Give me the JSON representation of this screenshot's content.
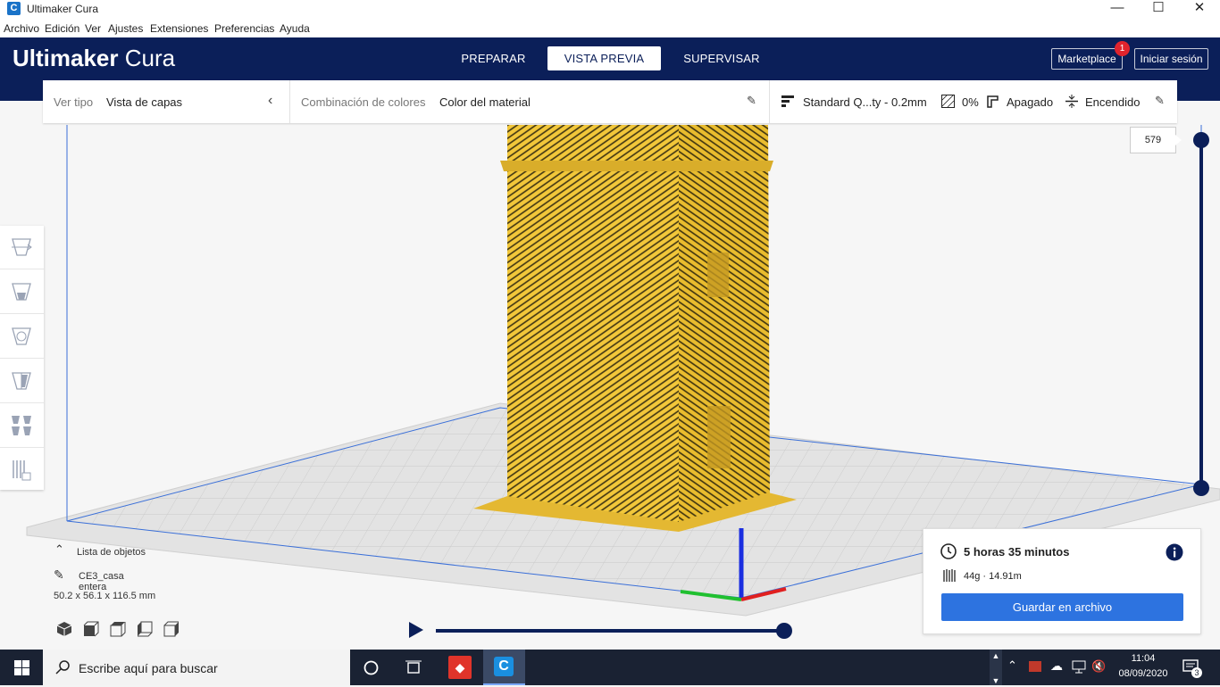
{
  "window": {
    "title": "Ultimaker Cura",
    "app_icon": "cura-icon",
    "minimize": "—",
    "maximize": "☐",
    "close": "✕"
  },
  "menu": [
    "Archivo",
    "Edición",
    "Ver",
    "Ajustes",
    "Extensiones",
    "Preferencias",
    "Ayuda"
  ],
  "header": {
    "brand_bold": "Ultimaker",
    "brand_light": "Cura",
    "tabs": [
      {
        "label": "PREPARAR",
        "active": false
      },
      {
        "label": "VISTA PREVIA",
        "active": true
      },
      {
        "label": "SUPERVISAR",
        "active": false
      }
    ],
    "marketplace": "Marketplace",
    "marketplace_badge": "1",
    "signin": "Iniciar sesión"
  },
  "viewbar": {
    "view_type_label": "Ver tipo",
    "view_type_value": "Vista de capas",
    "color_scheme_label": "Combinación de colores",
    "color_scheme_value": "Color del material",
    "profile": "Standard Q...ty - 0.2mm",
    "infill": "0%",
    "support": "Apagado",
    "adhesion": "Encendido"
  },
  "layer_slider": {
    "current_layer": "579"
  },
  "object_list": {
    "header": "Lista de objetos",
    "object_name": "CE3_casa entera",
    "dimensions": "50.2 x 56.1 x 116.5 mm"
  },
  "print_info": {
    "time": "5 horas 35 minutos",
    "material": "44g · 14.91m",
    "save_button": "Guardar en archivo"
  },
  "taskbar": {
    "search_placeholder": "Escribe aquí para buscar",
    "time": "11:04",
    "date": "08/09/2020",
    "notification_count": "3"
  },
  "colors": {
    "header_bg": "#0b1f59",
    "model_yellow": "#f2c73a",
    "accent_blue": "#2d73e0",
    "taskbar_bg": "#1a2233"
  }
}
